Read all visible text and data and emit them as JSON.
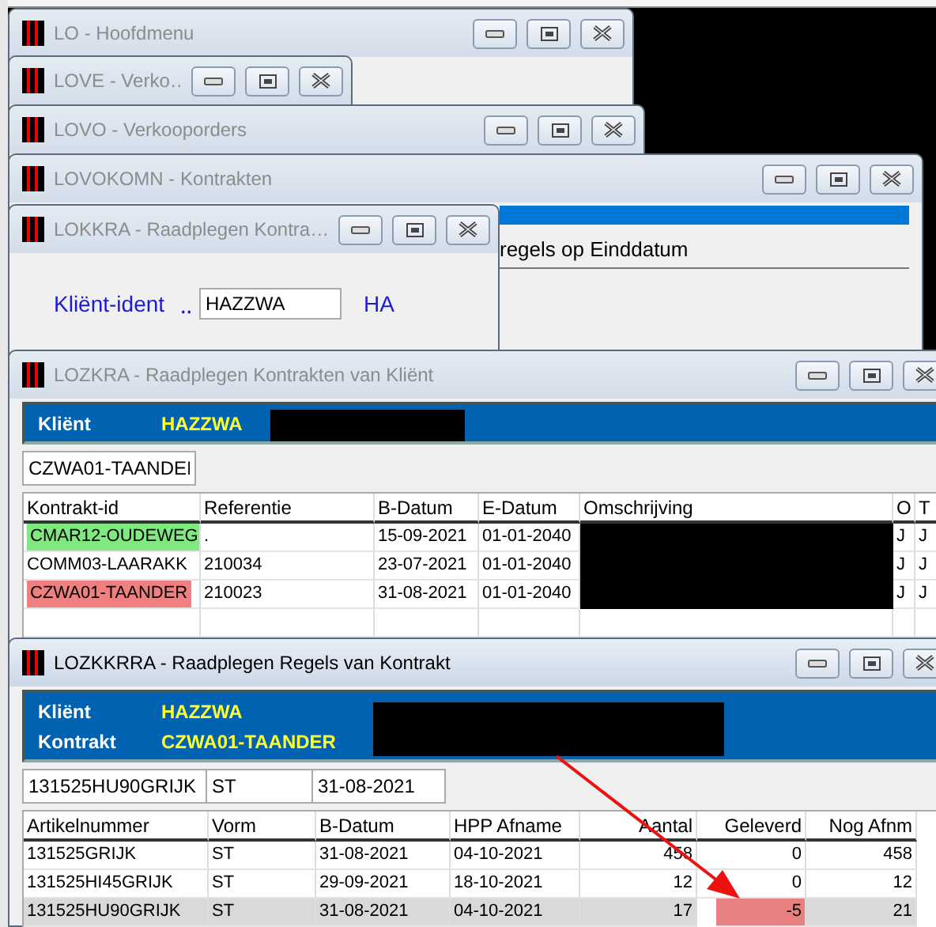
{
  "windows": [
    {
      "kind": "plain",
      "title": "LO - Hoofdmenu",
      "active": false
    },
    {
      "kind": "plain",
      "title": "LOVE - Verko…",
      "active": false
    },
    {
      "kind": "plain",
      "title": "LOVO - Verkooporders",
      "active": false
    },
    {
      "kind": "kontrakten",
      "title": "LOVOKOMN - Kontrakten",
      "active": false,
      "option": "regels op Einddatum"
    },
    {
      "kind": "ident",
      "title": "LOKKRA - Raadplegen Kontra…",
      "active": false,
      "label": "Kliënt-ident",
      "dots": "‥",
      "value": "HAZZWA",
      "hint": "HA"
    },
    {
      "kind": "contracts",
      "title": "LOZKRA - Raadplegen Kontrakten van Kliënt",
      "active": false,
      "header": [
        {
          "label": "Kliënt",
          "value": "HAZZWA"
        }
      ],
      "filter": [
        "CZWA01-TAANDEI"
      ],
      "columns": [
        "Kontrakt-id",
        "Referentie",
        "B-Datum",
        "E-Datum",
        "Omschrijving",
        "O",
        "T"
      ],
      "rows": [
        {
          "cells": [
            "CMAR12-OUDEWEG",
            ".",
            "15-09-2021",
            "01-01-2040",
            "",
            "J",
            "J"
          ],
          "color": "#7fe87f",
          "selected": false
        },
        {
          "cells": [
            "COMM03-LAARAKK",
            "210034",
            "23-07-2021",
            "01-01-2040",
            "",
            "J",
            "J"
          ],
          "selected": false
        },
        {
          "cells": [
            "CZWA01-TAANDER",
            "210023",
            "31-08-2021",
            "01-01-2040",
            "",
            "J",
            "J"
          ],
          "color": "#f08080",
          "selected": false
        }
      ]
    },
    {
      "kind": "lines",
      "title": "LOZKKRRA - Raadplegen Regels van Kontrakt",
      "active": true,
      "header": [
        {
          "label": "Kliënt",
          "value": "HAZZWA"
        },
        {
          "label": "Kontrakt",
          "value": "CZWA01-TAANDER"
        }
      ],
      "filter": [
        "131525HU90GRIJK",
        "ST",
        "31-08-2021"
      ],
      "columns": [
        "Artikelnummer",
        "Vorm",
        "B-Datum",
        "HPP Afname",
        "Aantal",
        "Geleverd",
        "Nog Afnm"
      ],
      "rows": [
        {
          "cells": [
            "131525GRIJK",
            "ST",
            "31-08-2021",
            "04-10-2021",
            "458",
            "0",
            "458"
          ],
          "selected": false
        },
        {
          "cells": [
            "131525HI45GRIJK",
            "ST",
            "29-09-2021",
            "18-10-2021",
            "12",
            "0",
            "12"
          ],
          "selected": false
        },
        {
          "cells": [
            "131525HU90GRIJK",
            "ST",
            "31-08-2021",
            "04-10-2021",
            "17",
            "-5",
            "21"
          ],
          "color": "#e88080",
          "selected": true
        }
      ]
    }
  ]
}
